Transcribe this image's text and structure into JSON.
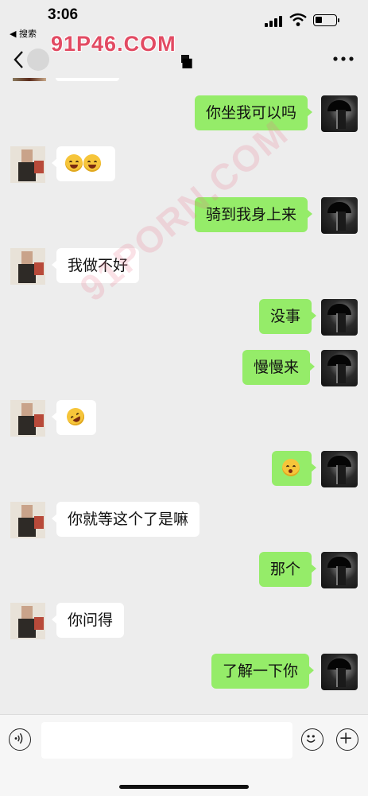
{
  "status_bar": {
    "time": "3:06",
    "back_app": "◀ 搜索"
  },
  "nav": {
    "title": "■"
  },
  "watermarks": {
    "top": "91P46.COM",
    "diagonal": "91PORN.COM"
  },
  "messages": [
    {
      "id": "m1",
      "side": "out",
      "text": "你坐我可以吗"
    },
    {
      "id": "m2",
      "side": "in",
      "emoji": [
        "tears-of-joy-emoji",
        "tears-of-joy-emoji"
      ]
    },
    {
      "id": "m3",
      "side": "out",
      "text": "骑到我身上来"
    },
    {
      "id": "m4",
      "side": "in",
      "text": "我做不好"
    },
    {
      "id": "m5",
      "side": "out",
      "text": "没事"
    },
    {
      "id": "m6",
      "side": "out",
      "text": "慢慢来"
    },
    {
      "id": "m7",
      "side": "in",
      "emoji": [
        "rolling-laughing-emoji"
      ]
    },
    {
      "id": "m8",
      "side": "out",
      "emoji": [
        "kissing-emoji"
      ]
    },
    {
      "id": "m9",
      "side": "in",
      "text": "你就等这个了是嘛"
    },
    {
      "id": "m10",
      "side": "out",
      "text": "那个"
    },
    {
      "id": "m11",
      "side": "in",
      "text": "你问得"
    },
    {
      "id": "m12",
      "side": "out",
      "text": "了解一下你"
    }
  ],
  "input": {
    "placeholder": ""
  },
  "colors": {
    "background": "#ededed",
    "bubble_out": "#95ec69",
    "bubble_in": "#ffffff",
    "watermark": "#e24b63"
  }
}
